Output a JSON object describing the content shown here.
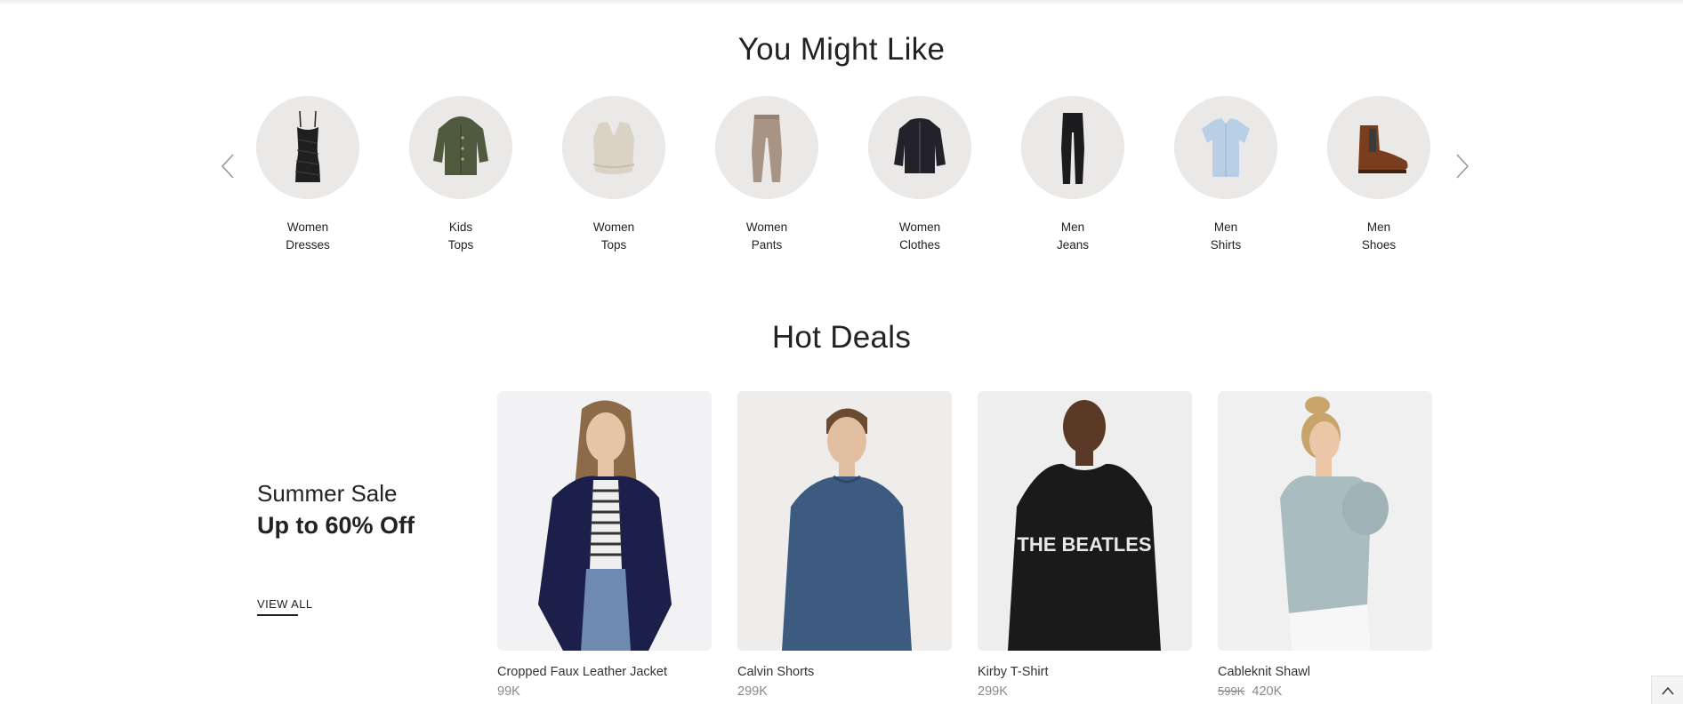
{
  "sections": {
    "might_like_title": "You Might Like",
    "hot_deals_title": "Hot Deals"
  },
  "carousel": {
    "prev_icon": "chevron-left-icon",
    "next_icon": "chevron-right-icon",
    "categories": [
      {
        "line1": "Women",
        "line2": "Dresses",
        "icon": "dress-icon"
      },
      {
        "line1": "Kids",
        "line2": "Tops",
        "icon": "kids-jacket-icon"
      },
      {
        "line1": "Women",
        "line2": "Tops",
        "icon": "sweater-vest-icon"
      },
      {
        "line1": "Women",
        "line2": "Pants",
        "icon": "pants-icon"
      },
      {
        "line1": "Women",
        "line2": "Clothes",
        "icon": "puffer-jacket-icon"
      },
      {
        "line1": "Men",
        "line2": "Jeans",
        "icon": "jeans-icon"
      },
      {
        "line1": "Men",
        "line2": "Shirts",
        "icon": "shirt-icon"
      },
      {
        "line1": "Men",
        "line2": "Shoes",
        "icon": "boot-icon"
      }
    ]
  },
  "promo": {
    "subtitle": "Summer Sale",
    "headline": "Up to 60% Off",
    "view_all": "VIEW ALL"
  },
  "products": [
    {
      "name": "Cropped Faux Leather Jacket",
      "price": "99K",
      "old_price": ""
    },
    {
      "name": "Calvin Shorts",
      "price": "299K",
      "old_price": ""
    },
    {
      "name": "Kirby T-Shirt",
      "price": "299K",
      "old_price": ""
    },
    {
      "name": "Cableknit Shawl",
      "price": "420K",
      "old_price": "599K"
    }
  ],
  "print_text": {
    "beatles": "THE BEATLES"
  },
  "scroll_top_icon": "chevron-up-icon",
  "colors": {
    "text": "#222222",
    "price": "#888888",
    "circle_bg": "#ebe9e7"
  }
}
